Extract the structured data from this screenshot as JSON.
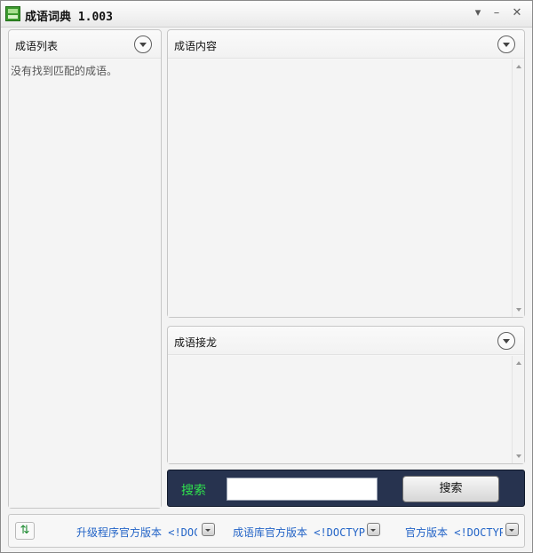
{
  "window": {
    "title": "成语词典 1.003",
    "controls": [
      "minimize-menu",
      "minimize",
      "close"
    ]
  },
  "idiom_list": {
    "title": "成语列表",
    "empty_message": "没有找到匹配的成语。"
  },
  "idiom_content": {
    "title": "成语内容"
  },
  "idiom_chain": {
    "title": "成语接龙"
  },
  "search": {
    "label": "搜索",
    "value": "",
    "button_label": "搜索"
  },
  "footer": {
    "links": [
      {
        "label": "升级程序官方版本 <!DOC"
      },
      {
        "label": "成语库官方版本 <!DOCTYP"
      },
      {
        "label": "官方版本 <!DOCTYP"
      }
    ]
  },
  "colors": {
    "search_bar_bg": "#27334f",
    "search_label": "#2fe24d",
    "link": "#2364c7"
  },
  "icons": {
    "app": "dictionary-app-icon",
    "refresh": "refresh-icon",
    "collapse": "chevron-down-circle-icon"
  }
}
